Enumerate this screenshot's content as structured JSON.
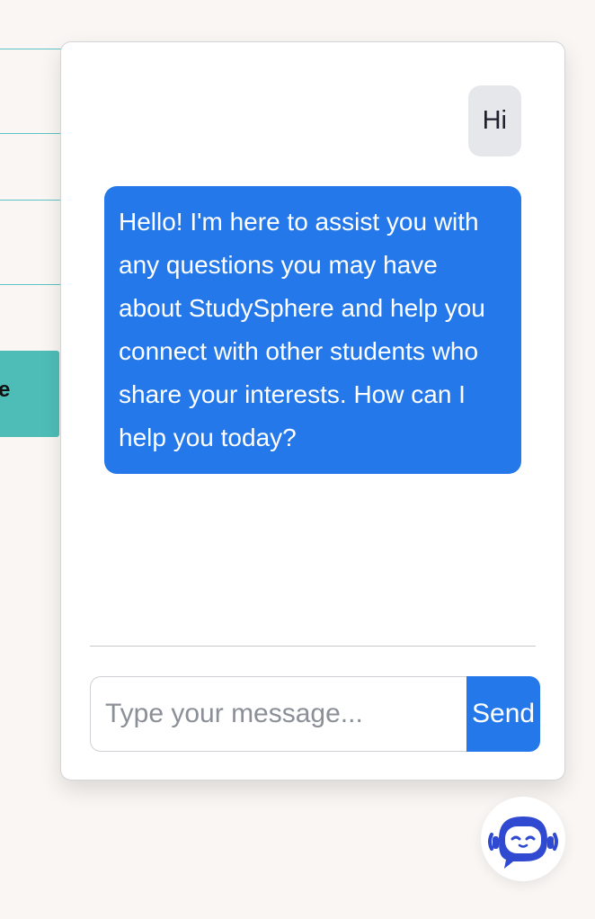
{
  "background": {
    "partial_button_label": "e"
  },
  "chat": {
    "messages": [
      {
        "role": "user",
        "text": "Hi"
      },
      {
        "role": "bot",
        "text": "Hello! I'm here to assist you with any questions you may have about StudySphere and help you connect with other students who share your interests. How can I help you today?"
      }
    ],
    "input": {
      "value": "",
      "placeholder": "Type your message..."
    },
    "send_label": "Send"
  },
  "launcher": {
    "icon": "chatbot-icon"
  },
  "colors": {
    "accent": "#2478ea",
    "user_bubble": "#e5e7eb",
    "background_teal": "#4ebdb8",
    "launcher_icon": "#2f49d1"
  }
}
